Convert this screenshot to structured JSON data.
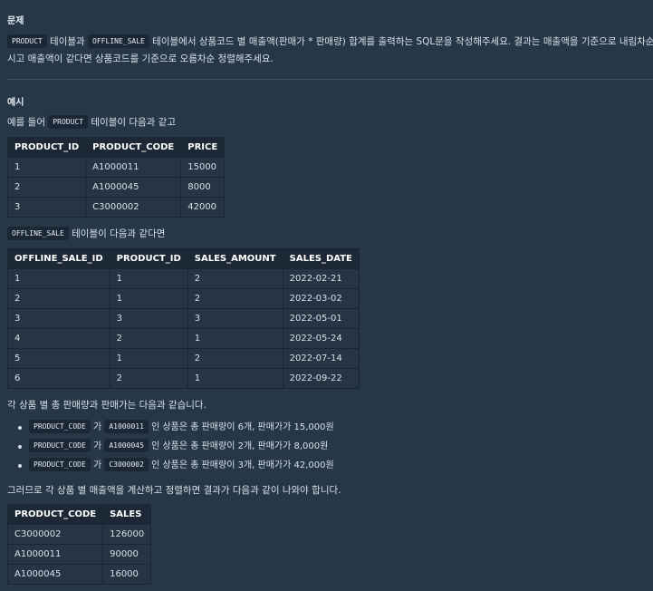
{
  "problem": {
    "heading": "문제",
    "line1": {
      "code1": "PRODUCT",
      "t1": " 테이블과 ",
      "code2": "OFFLINE_SALE",
      "t2": " 테이블에서 상품코드 별 매출액(판매가 * 판매량) 합계를 출력하는 SQL문을 작성해주세요. 결과는 매출액을 기준으로 내림차순 정렬해"
    },
    "line2": "시고 매출액이 같다면 상품코드를 기준으로 오름차순 정렬해주세요."
  },
  "example": {
    "heading": "예시",
    "intro": {
      "t1": "예를 들어 ",
      "code": "PRODUCT",
      "t2": " 테이블이 다음과 같고"
    },
    "product_table": {
      "headers": [
        "PRODUCT_ID",
        "PRODUCT_CODE",
        "PRICE"
      ],
      "rows": [
        [
          "1",
          "A1000011",
          "15000"
        ],
        [
          "2",
          "A1000045",
          "8000"
        ],
        [
          "3",
          "C3000002",
          "42000"
        ]
      ]
    },
    "offline_intro": {
      "code": "OFFLINE_SALE",
      "t": " 테이블이 다음과 같다면"
    },
    "offline_table": {
      "headers": [
        "OFFLINE_SALE_ID",
        "PRODUCT_ID",
        "SALES_AMOUNT",
        "SALES_DATE"
      ],
      "rows": [
        [
          "1",
          "1",
          "2",
          "2022-02-21"
        ],
        [
          "2",
          "1",
          "2",
          "2022-03-02"
        ],
        [
          "3",
          "3",
          "3",
          "2022-05-01"
        ],
        [
          "4",
          "2",
          "1",
          "2022-05-24"
        ],
        [
          "5",
          "1",
          "2",
          "2022-07-14"
        ],
        [
          "6",
          "2",
          "1",
          "2022-09-22"
        ]
      ]
    },
    "summary_intro": "각 상품 별 총 판매량과 판매가는 다음과 같습니다.",
    "bullets": [
      {
        "code1": "PRODUCT_CODE",
        "t1": " 가 ",
        "code2": "A1000011",
        "t2": " 인 상품은 총 판매량이 6개, 판매가가 15,000원"
      },
      {
        "code1": "PRODUCT_CODE",
        "t1": " 가 ",
        "code2": "A1000045",
        "t2": " 인 상품은 총 판매량이 2개, 판매가가 8,000원"
      },
      {
        "code1": "PRODUCT_CODE",
        "t1": " 가 ",
        "code2": "C3000002",
        "t2": " 인 상품은 총 판매량이 3개, 판매가가 42,000원"
      }
    ],
    "result_intro": "그러므로 각 상품 별 매출액을 계산하고 정렬하면 결과가 다음과 같이 나와야 합니다.",
    "result_table": {
      "headers": [
        "PRODUCT_CODE",
        "SALES"
      ],
      "rows": [
        [
          "C3000002",
          "126000"
        ],
        [
          "A1000011",
          "90000"
        ],
        [
          "A1000045",
          "16000"
        ]
      ]
    }
  }
}
